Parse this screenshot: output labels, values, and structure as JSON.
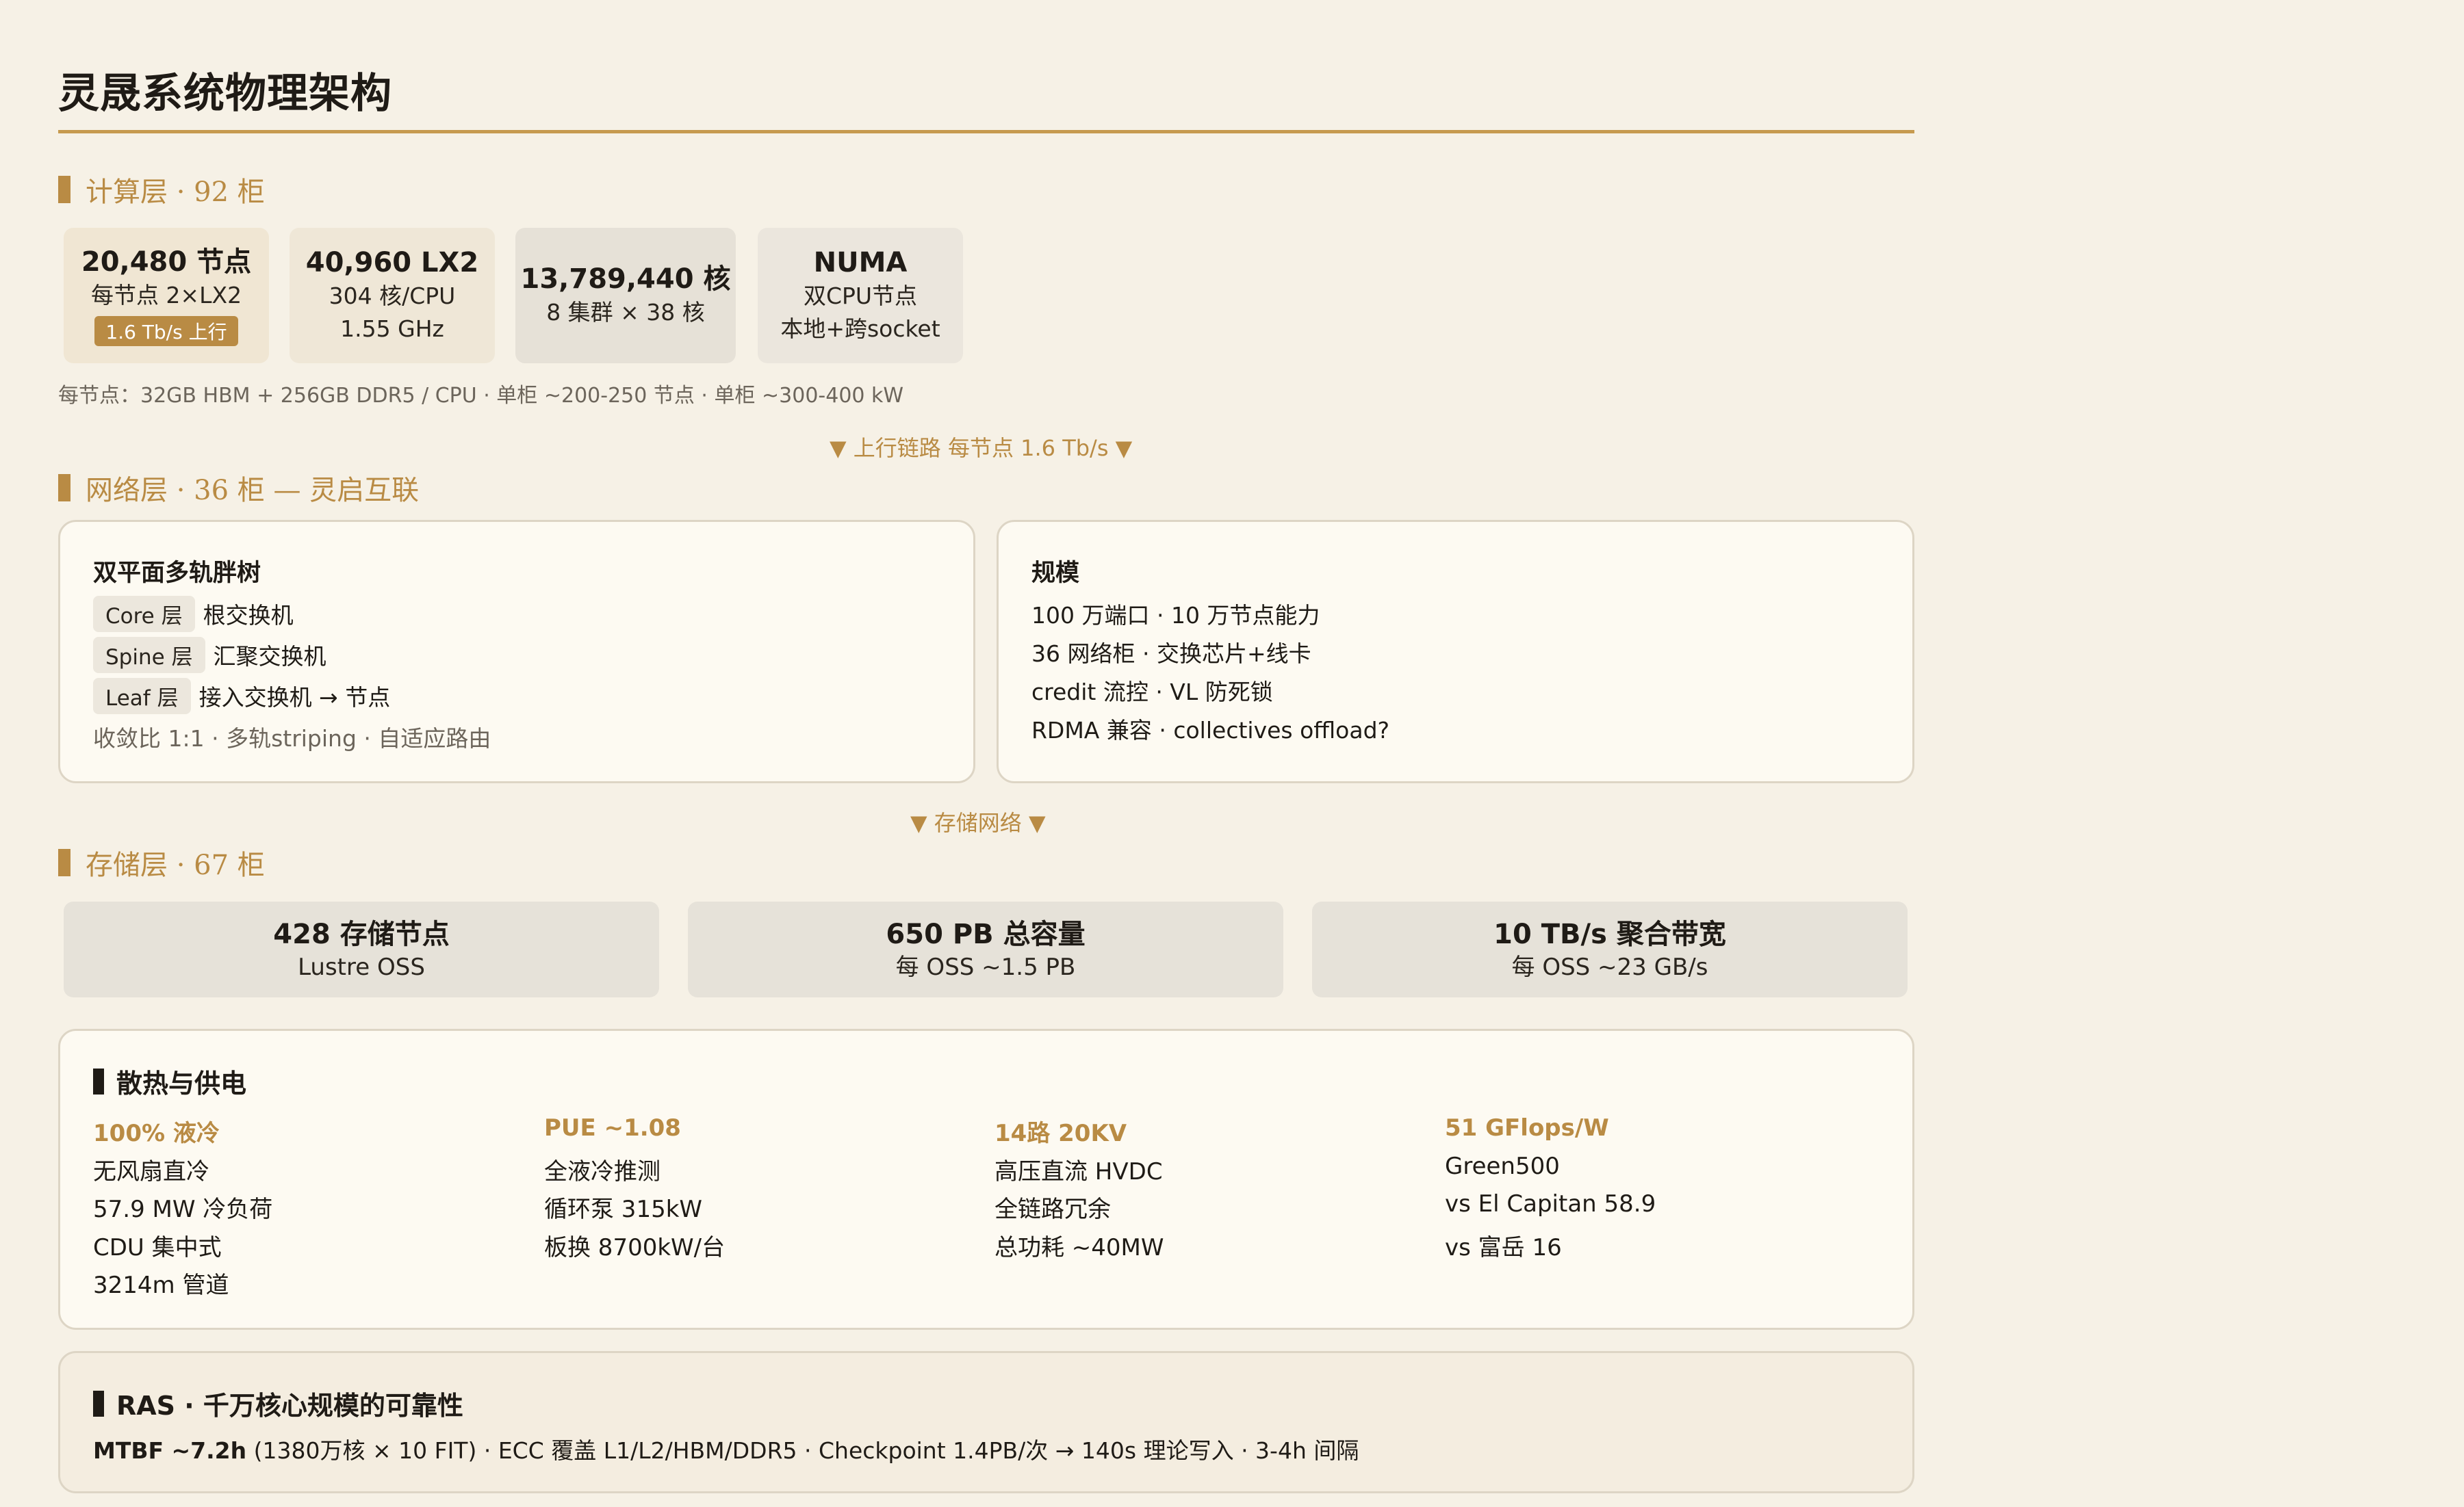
{
  "title": "灵晟系统物理架构",
  "compute": {
    "heading": "计算层 · 92 柜",
    "cards": [
      {
        "big": "20,480 节点",
        "lines": [
          "每节点 2×LX2"
        ],
        "badge": "1.6 Tb/s 上行"
      },
      {
        "big": "40,960 LX2",
        "lines": [
          "304 核/CPU",
          "1.55 GHz"
        ]
      },
      {
        "big": "13,789,440 核",
        "lines": [
          "8 集群 × 38 核"
        ]
      },
      {
        "big": "NUMA",
        "lines": [
          "双CPU节点",
          "本地+跨socket"
        ]
      }
    ],
    "note": "每节点：32GB HBM + 256GB DDR5 / CPU · 单柜 ~200-250 节点 · 单柜 ~300-400 kW"
  },
  "arrow_uplink": "▼ 上行链路 每节点 1.6 Tb/s ▼",
  "network": {
    "heading": "网络层 · 36 柜 — 灵启互联",
    "left": {
      "title": "双平面多轨胖树",
      "rows": [
        {
          "tag": "Core 层",
          "text": "根交换机"
        },
        {
          "tag": "Spine 层",
          "text": "汇聚交换机"
        },
        {
          "tag": "Leaf 层",
          "text": "接入交换机 → 节点"
        }
      ],
      "footer": "收敛比 1:1 · 多轨striping · 自适应路由"
    },
    "right": {
      "title": "规模",
      "lines": [
        "100 万端口 · 10 万节点能力",
        "36 网络柜 · 交换芯片+线卡",
        "credit 流控 · VL 防死锁",
        "RDMA 兼容 · collectives offload?"
      ]
    }
  },
  "arrow_storage": "▼ 存储网络 ▼",
  "storage": {
    "heading": "存储层 · 67 柜",
    "cards": [
      {
        "big": "428 存储节点",
        "small": "Lustre OSS"
      },
      {
        "big": "650 PB 总容量",
        "small": "每 OSS ~1.5 PB"
      },
      {
        "big": "10 TB/s 聚合带宽",
        "small": "每 OSS ~23 GB/s"
      }
    ]
  },
  "cooling": {
    "title": "散热与供电",
    "columns": [
      {
        "head": "100% 液冷",
        "lines": [
          "无风扇直冷",
          "57.9 MW 冷负荷",
          "CDU 集中式",
          "3214m 管道"
        ]
      },
      {
        "head": "PUE ~1.08",
        "lines": [
          "全液冷推测",
          "循环泵 315kW",
          "板换 8700kW/台"
        ]
      },
      {
        "head": "14路 20KV",
        "lines": [
          "高压直流 HVDC",
          "全链路冗余",
          "总功耗 ~40MW"
        ]
      },
      {
        "head": "51 GFlops/W",
        "lines": [
          "Green500",
          "vs El Capitan 58.9",
          "vs 富岳 16"
        ]
      }
    ]
  },
  "ras": {
    "title": "RAS · 千万核心规模的可靠性",
    "bold": "MTBF ~7.2h",
    "rest": " (1380万核 × 10 FIT) · ECC 覆盖 L1/L2/HBM/DDR5 · Checkpoint 1.4PB/次 → 140s 理论写入 · 3-4h 间隔"
  }
}
